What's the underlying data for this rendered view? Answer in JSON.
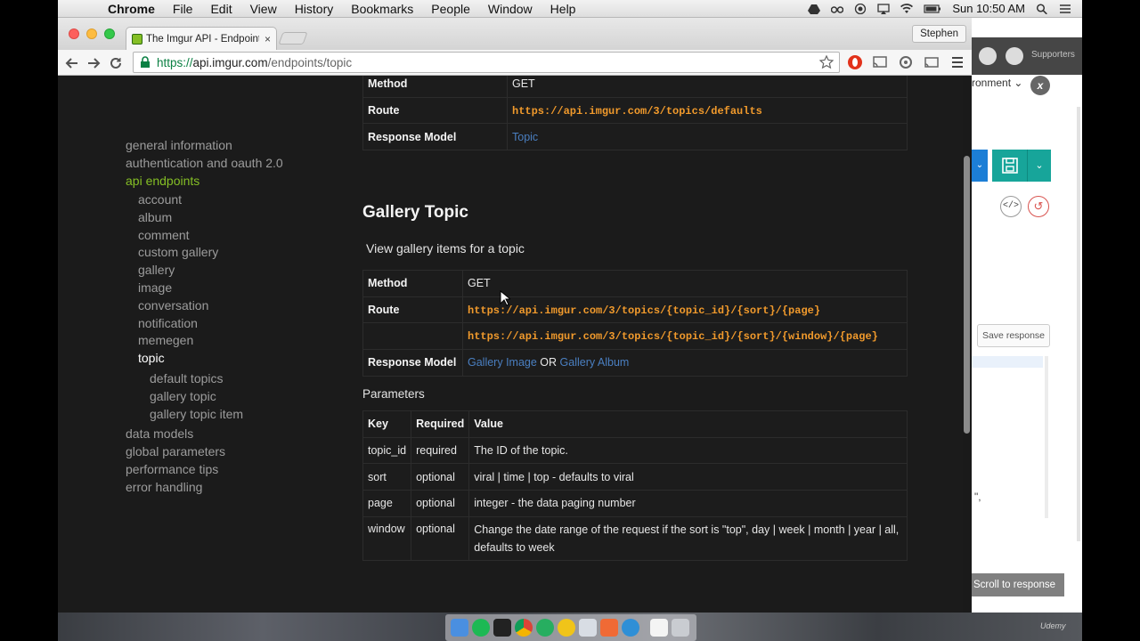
{
  "menubar": {
    "apple": "",
    "app": "Chrome",
    "items": [
      "File",
      "Edit",
      "View",
      "History",
      "Bookmarks",
      "People",
      "Window",
      "Help"
    ],
    "clock": "Sun 10:50 AM"
  },
  "browser": {
    "tab_title": "The Imgur API - Endpoints",
    "tab_close": "×",
    "profile": "Stephen",
    "url_scheme": "https://",
    "url_host": "api.imgur.com",
    "url_path": "/endpoints/topic"
  },
  "sidenav": {
    "top": [
      "general information",
      "authentication and oauth 2.0"
    ],
    "active": "api endpoints",
    "endpoints": [
      "account",
      "album",
      "comment",
      "custom gallery",
      "gallery",
      "image",
      "conversation",
      "notification",
      "memegen"
    ],
    "current": "topic",
    "topic_children": [
      "default topics",
      "gallery topic",
      "gallery topic item"
    ],
    "bottom": [
      "data models",
      "global parameters",
      "performance tips",
      "error handling"
    ]
  },
  "defaults_table": {
    "method_label": "Method",
    "method_value": "GET",
    "route_label": "Route",
    "route_value": "https://api.imgur.com/3/topics/defaults",
    "model_label": "Response Model",
    "model_value": "Topic"
  },
  "gallery_topic": {
    "title": "Gallery Topic",
    "description": "View gallery items for a topic",
    "method_label": "Method",
    "method_value": "GET",
    "route_label": "Route",
    "route_1": "https://api.imgur.com/3/topics/{topic_id}/{sort}/{page}",
    "route_2": "https://api.imgur.com/3/topics/{topic_id}/{sort}/{window}/{page}",
    "model_label": "Response Model",
    "model_a": "Gallery Image",
    "model_or": "OR",
    "model_b": "Gallery Album",
    "params_label": "Parameters",
    "params_headers": [
      "Key",
      "Required",
      "Value"
    ],
    "params_rows": [
      [
        "topic_id",
        "required",
        "The ID of the topic."
      ],
      [
        "sort",
        "optional",
        "viral | time | top - defaults to viral"
      ],
      [
        "page",
        "optional",
        "integer - the data paging number"
      ],
      [
        "window",
        "optional",
        "Change the date range of the request if the sort is \"top\", day | week | month | year | all, defaults to week"
      ]
    ]
  },
  "bg_app": {
    "supporters": "Supporters",
    "environment": "ronment",
    "save_response": "Save response",
    "quote_fragment": "\",",
    "scroll_to_response": "Scroll to response"
  },
  "watermark": "Udemy",
  "colors": {
    "imgur_green": "#85bf25",
    "route_orange": "#f19a2c",
    "link_blue": "#4a7fc1",
    "page_bg": "#1b1b1b"
  }
}
